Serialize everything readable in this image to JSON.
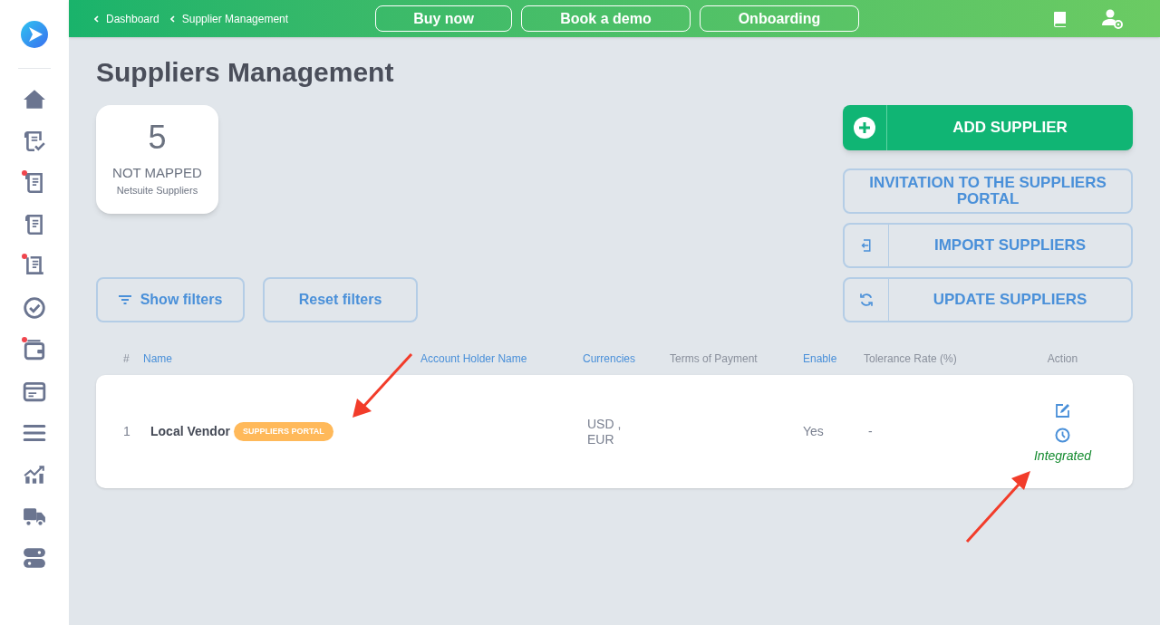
{
  "sidebar": {
    "items": [
      {
        "kind": "home",
        "badge": false
      },
      {
        "kind": "doc-check",
        "badge": false
      },
      {
        "kind": "doc",
        "badge": true
      },
      {
        "kind": "doc",
        "badge": false
      },
      {
        "kind": "receipt",
        "badge": true
      },
      {
        "kind": "check-circle",
        "badge": false
      },
      {
        "kind": "wallet",
        "badge": true
      },
      {
        "kind": "card",
        "badge": false
      },
      {
        "kind": "menu",
        "badge": false
      },
      {
        "kind": "chart",
        "badge": false
      },
      {
        "kind": "truck",
        "badge": false
      },
      {
        "kind": "toggles",
        "badge": false
      }
    ]
  },
  "topbar": {
    "breadcrumbs": [
      "Dashboard",
      "Supplier Management"
    ],
    "buttons": [
      "Buy now",
      "Book a demo",
      "Onboarding"
    ]
  },
  "title": "Suppliers Management",
  "stat_card": {
    "value": "5",
    "label": "NOT MAPPED",
    "sublabel": "Netsuite Suppliers"
  },
  "actions": [
    {
      "kind": "add",
      "label": "ADD SUPPLIER"
    },
    {
      "kind": "plain",
      "label": "INVITATION TO THE SUPPLIERS PORTAL"
    },
    {
      "kind": "import",
      "label": "IMPORT SUPPLIERS"
    },
    {
      "kind": "update",
      "label": "UPDATE SUPPLIERS"
    }
  ],
  "filters": [
    {
      "kind": "show",
      "label": "Show filters"
    },
    {
      "kind": "reset",
      "label": "Reset filters"
    }
  ],
  "table": {
    "columns": [
      {
        "label": "#",
        "sortable": false
      },
      {
        "label": "Name",
        "sortable": true
      },
      {
        "label": "Account Holder Name",
        "sortable": true
      },
      {
        "label": "Currencies",
        "sortable": true
      },
      {
        "label": "Terms of Payment",
        "sortable": false
      },
      {
        "label": "Enable",
        "sortable": true
      },
      {
        "label": "Tolerance Rate (%)",
        "sortable": false
      },
      {
        "label": "Action",
        "sortable": false
      }
    ],
    "rows": [
      {
        "index": "1",
        "name": "Local Vendor",
        "badge": "SUPPLIERS PORTAL",
        "account_holder": "",
        "currencies": [
          "USD ,",
          "EUR"
        ],
        "terms": "",
        "enable": "Yes",
        "tolerance": "-",
        "status": "Integrated"
      }
    ]
  }
}
